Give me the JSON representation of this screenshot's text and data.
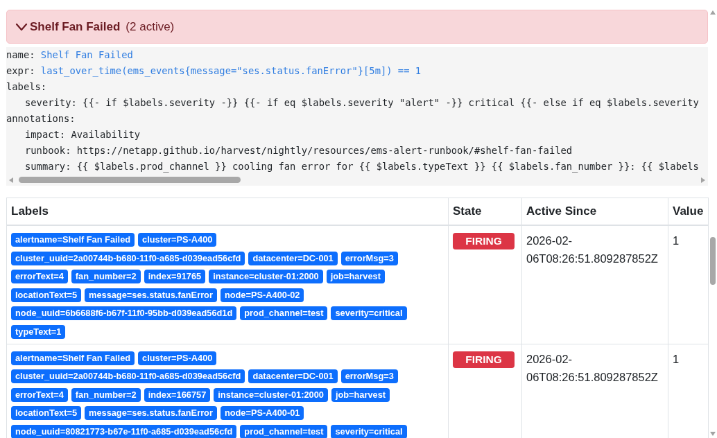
{
  "alert_group": {
    "title": "Shelf Fan Failed",
    "count": "(2 active)",
    "expanded": true
  },
  "rule_definition": [
    {
      "key": "name:",
      "value": "Shelf Fan Failed",
      "kind": "highlighted"
    },
    {
      "key": "expr:",
      "value": "last_over_time(ems_events{message=\"ses.status.fanError\"}[5m]) == 1",
      "kind": "highlighted"
    },
    {
      "key": "labels:",
      "kind": "section",
      "children": [
        {
          "key": "severity:",
          "value": "{{- if $labels.severity -}} {{- if eq $labels.severity \"alert\" -}} critical {{- else if eq $labels.severity",
          "kind": "plain"
        }
      ]
    },
    {
      "key": "annotations:",
      "kind": "section",
      "children": [
        {
          "key": "impact:",
          "value": "Availability",
          "kind": "plain"
        },
        {
          "key": "runbook:",
          "value": "https://netapp.github.io/harvest/nightly/resources/ems-alert-runbook/#shelf-fan-failed",
          "kind": "plain"
        },
        {
          "key": "summary:",
          "value": "{{ $labels.prod_channel }} cooling fan error for {{ $labels.typeText }} {{ $labels.fan_number }}: {{ $labels",
          "kind": "plain"
        }
      ]
    }
  ],
  "table": {
    "columns": [
      "Labels",
      "State",
      "Active Since",
      "Value"
    ],
    "rows": [
      {
        "labels": [
          "alertname=Shelf Fan Failed",
          "cluster=PS-A400",
          "cluster_uuid=2a00744b-b680-11f0-a685-d039ead56cfd",
          "datacenter=DC-001",
          "errorMsg=3",
          "errorText=4",
          "fan_number=2",
          "index=91765",
          "instance=cluster-01:2000",
          "job=harvest",
          "locationText=5",
          "message=ses.status.fanError",
          "node=PS-A400-02",
          "node_uuid=6b6688f6-b67f-11f0-95bb-d039ead56d1d",
          "prod_channel=test",
          "severity=critical",
          "typeText=1"
        ],
        "state": {
          "label": "FIRING",
          "kind": "firing"
        },
        "active_since": "2026-02-06T08:26:51.809287852Z",
        "value": "1"
      },
      {
        "labels": [
          "alertname=Shelf Fan Failed",
          "cluster=PS-A400",
          "cluster_uuid=2a00744b-b680-11f0-a685-d039ead56cfd",
          "datacenter=DC-001",
          "errorMsg=3",
          "errorText=4",
          "fan_number=2",
          "index=166757",
          "instance=cluster-01:2000",
          "job=harvest",
          "locationText=5",
          "message=ses.status.fanError",
          "node=PS-A400-01",
          "node_uuid=80821773-b67e-11f0-a685-d039ead56cfd",
          "prod_channel=test",
          "severity=critical"
        ],
        "state": {
          "label": "FIRING",
          "kind": "firing"
        },
        "active_since": "2026-02-06T08:26:51.809287852Z",
        "value": "1"
      }
    ]
  }
}
